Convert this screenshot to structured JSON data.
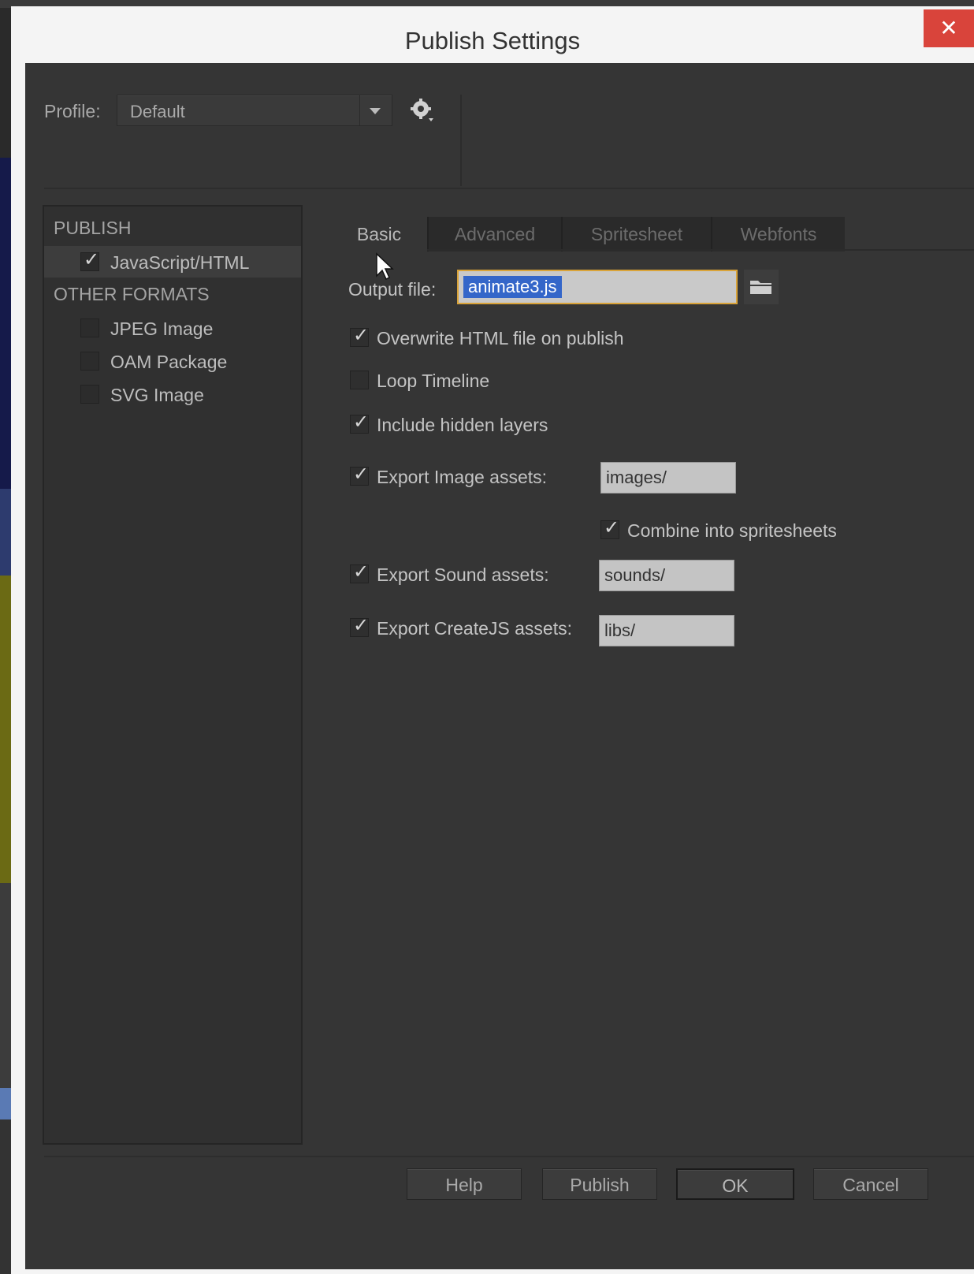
{
  "window": {
    "title": "Publish Settings",
    "close_label": "✕"
  },
  "profile": {
    "label": "Profile:",
    "value": "Default"
  },
  "left_panel": {
    "publish_heading": "PUBLISH",
    "publish_items": [
      {
        "label": "JavaScript/HTML",
        "checked": true
      }
    ],
    "other_heading": "OTHER FORMATS",
    "other_items": [
      {
        "label": "JPEG Image",
        "checked": false
      },
      {
        "label": "OAM Package",
        "checked": false
      },
      {
        "label": "SVG Image",
        "checked": false
      }
    ]
  },
  "tabs": [
    {
      "label": "Basic",
      "active": true
    },
    {
      "label": "Advanced",
      "active": false
    },
    {
      "label": "Spritesheet",
      "active": false
    },
    {
      "label": "Webfonts",
      "active": false
    }
  ],
  "basic": {
    "output_label": "Output file:",
    "output_value": "animate3.js",
    "overwrite_label": "Overwrite HTML file on publish",
    "loop_label": "Loop Timeline",
    "hidden_layers_label": "Include hidden layers",
    "export_images_label": "Export Image assets:",
    "images_path": "images/",
    "combine_label": "Combine into spritesheets",
    "export_sounds_label": "Export Sound assets:",
    "sounds_path": "sounds/",
    "export_createjs_label": "Export CreateJS assets:",
    "libs_path": "libs/"
  },
  "footer": {
    "help": "Help",
    "publish": "Publish",
    "ok": "OK",
    "cancel": "Cancel"
  },
  "colors": {
    "dialog_bg": "#353535",
    "close_red": "#d9443b",
    "selection_blue": "#3466c9",
    "focus_orange": "#d9a339"
  }
}
